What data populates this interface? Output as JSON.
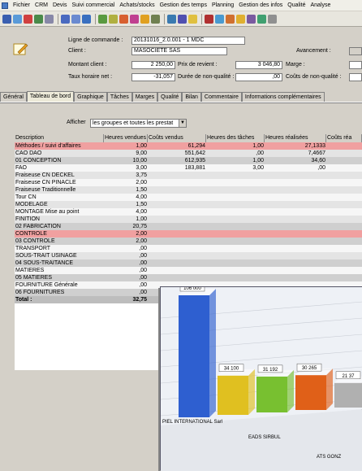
{
  "menu": [
    "Fichier",
    "CRM",
    "Devis",
    "Suivi commercial",
    "Achats/stocks",
    "Gestion des temps",
    "Planning",
    "Gestion des infos",
    "Qualité",
    "Analyse"
  ],
  "header": {
    "commande_label": "Ligne de commande :",
    "commande_value": "20131016_2.0.001 - 1 MDC",
    "client_label": "Client :",
    "client_value": "MASOCIETE SAS",
    "avancement_label": "Avancement :",
    "montant_label": "Montant client :",
    "montant_value": "2 250,00",
    "prix_label": "Prix de revient :",
    "prix_value": "3 046,80",
    "marge_label": "Marge :",
    "taux_label": "Taux horaire net :",
    "taux_value": "-31,057",
    "duree_label": "Durée de non-qualité :",
    "duree_value": ",00",
    "couts_label": "Coûts de non-qualité :"
  },
  "tabs": [
    "Général",
    "Tableau de bord",
    "Graphique",
    "Tâches",
    "Marges",
    "Qualité",
    "Bilan",
    "Commentaire",
    "Informations complémentaires"
  ],
  "filter": {
    "label": "Afficher",
    "value": "les groupes et toutes les prestat"
  },
  "table": {
    "columns": [
      "Description",
      "Heures vendues",
      "Coûts vendus",
      "Heures des tâches",
      "Heures réalisées",
      "Coûts réa"
    ],
    "rows": [
      {
        "d": "Méthodes / suivi d'affaires",
        "hv": "1,00",
        "cv": "61,294",
        "ht": "1,00",
        "hr": "27,1333",
        "cr": "",
        "t": "hl"
      },
      {
        "d": "CAO DAO",
        "hv": "9,00",
        "cv": "551,642",
        "ht": ",00",
        "hr": "7,4667",
        "cr": "",
        "t": "odd"
      },
      {
        "d": "01     CONCEPTION",
        "hv": "10,00",
        "cv": "612,935",
        "ht": "1,00",
        "hr": "34,60",
        "cr": "",
        "t": "sec"
      },
      {
        "d": "FAO",
        "hv": "3,00",
        "cv": "183,881",
        "ht": "3,00",
        "hr": ",00",
        "cr": "",
        "t": "even"
      },
      {
        "d": "Fraiseuse CN DECKEL",
        "hv": "3,75",
        "cv": "",
        "ht": "",
        "hr": "",
        "cr": "",
        "t": "odd"
      },
      {
        "d": "Fraiseuse CN PINACLE",
        "hv": "2,00",
        "cv": "",
        "ht": "",
        "hr": "",
        "cr": "",
        "t": "even"
      },
      {
        "d": "Fraiseuse Traditionnelle",
        "hv": "1,50",
        "cv": "",
        "ht": "",
        "hr": "",
        "cr": "",
        "t": "odd"
      },
      {
        "d": "Tour CN",
        "hv": "4,00",
        "cv": "",
        "ht": "",
        "hr": "",
        "cr": "",
        "t": "even"
      },
      {
        "d": "MODELAGE",
        "hv": "1,50",
        "cv": "",
        "ht": "",
        "hr": "",
        "cr": "",
        "t": "odd"
      },
      {
        "d": "MONTAGE Mise au point",
        "hv": "4,00",
        "cv": "",
        "ht": "",
        "hr": "",
        "cr": "",
        "t": "even"
      },
      {
        "d": "FINITION",
        "hv": "1,00",
        "cv": "",
        "ht": "",
        "hr": "",
        "cr": "",
        "t": "odd"
      },
      {
        "d": "02     FABRICATION",
        "hv": "20,75",
        "cv": "",
        "ht": "",
        "hr": "",
        "cr": "",
        "t": "sec"
      },
      {
        "d": "CONTROLE",
        "hv": "2,00",
        "cv": "",
        "ht": "",
        "hr": "",
        "cr": "",
        "t": "hl"
      },
      {
        "d": "03     CONTROLE",
        "hv": "2,00",
        "cv": "",
        "ht": "",
        "hr": "",
        "cr": "",
        "t": "sec"
      },
      {
        "d": "TRANSPORT",
        "hv": ",00",
        "cv": "",
        "ht": "",
        "hr": "",
        "cr": "",
        "t": "even"
      },
      {
        "d": "SOUS-TRAIT USINAGE",
        "hv": ",00",
        "cv": "",
        "ht": "",
        "hr": "",
        "cr": "",
        "t": "odd"
      },
      {
        "d": "04     SOUS-TRAITANCE",
        "hv": ",00",
        "cv": "",
        "ht": "",
        "hr": "",
        "cr": "",
        "t": "sec"
      },
      {
        "d": "MATIERES",
        "hv": ",00",
        "cv": "",
        "ht": "",
        "hr": "",
        "cr": "",
        "t": "even"
      },
      {
        "d": "05     MATIERES",
        "hv": ",00",
        "cv": "",
        "ht": "",
        "hr": "",
        "cr": "",
        "t": "sec"
      },
      {
        "d": "FOURNITURE Générale",
        "hv": ",00",
        "cv": "",
        "ht": "",
        "hr": "",
        "cr": "",
        "t": "even"
      },
      {
        "d": "06     FOURNITURES",
        "hv": ",00",
        "cv": "",
        "ht": "",
        "hr": "",
        "cr": "",
        "t": "sec"
      },
      {
        "d": "Total :",
        "hv": "32,75",
        "cv": "",
        "ht": "",
        "hr": "",
        "cr": "",
        "t": "total"
      }
    ]
  },
  "chart_data": {
    "type": "bar",
    "categories": [
      "PIEL INTERNATIONAL Sarl",
      "EADS SIRBUL",
      "",
      "",
      "ATS GONZ"
    ],
    "values": [
      106000,
      34100,
      31192,
      30265,
      21370
    ],
    "data_labels": [
      "106 000",
      "34 100",
      "31 192",
      "30 265",
      "21 37"
    ],
    "colors": [
      "#2e5fd0",
      "#e0c020",
      "#78c030",
      "#e06018",
      "#b0b0b0"
    ]
  }
}
